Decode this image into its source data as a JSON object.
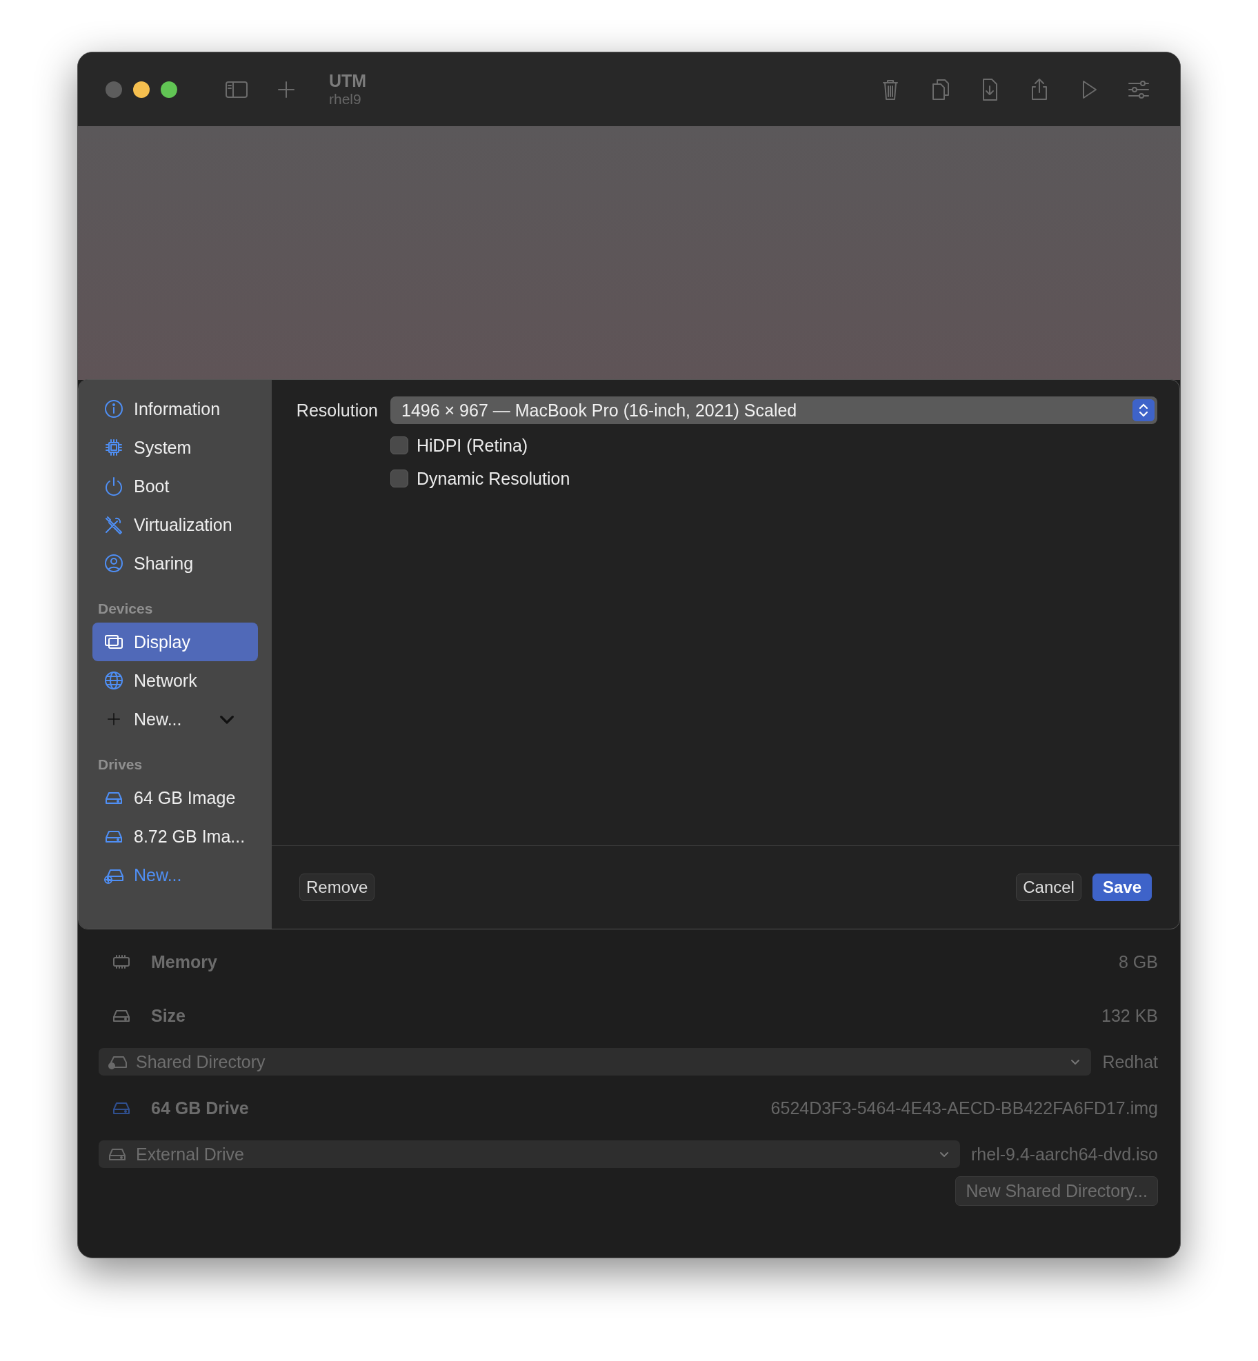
{
  "window": {
    "title": "UTM",
    "subtitle": "rhel9"
  },
  "sidebar": {
    "sections": [
      {
        "items": [
          {
            "kind": "item",
            "label": "Information",
            "selected": false
          },
          {
            "kind": "item",
            "label": "System",
            "selected": false
          },
          {
            "kind": "item",
            "label": "Boot",
            "selected": false
          },
          {
            "kind": "item",
            "label": "Virtualization",
            "selected": false
          },
          {
            "kind": "item",
            "label": "Sharing",
            "selected": false
          }
        ]
      },
      {
        "title": "Devices",
        "items": [
          {
            "kind": "item",
            "label": "Display",
            "selected": true
          },
          {
            "kind": "item",
            "label": "Network",
            "selected": false
          },
          {
            "kind": "add-menu",
            "label": "New..."
          }
        ]
      },
      {
        "title": "Drives",
        "items": [
          {
            "kind": "item",
            "label": "64 GB Image",
            "selected": false
          },
          {
            "kind": "item",
            "label": "8.72 GB Ima...",
            "selected": false
          },
          {
            "kind": "add-link",
            "label": "New..."
          }
        ]
      }
    ]
  },
  "display_settings": {
    "resolution_label": "Resolution",
    "resolution_value": "1496 × 967 — MacBook Pro (16-inch, 2021) Scaled",
    "options": [
      {
        "label": "HiDPI (Retina)",
        "checked": false
      },
      {
        "label": "Dynamic Resolution",
        "checked": false
      }
    ]
  },
  "sheet_buttons": {
    "remove": "Remove",
    "cancel": "Cancel",
    "save": "Save"
  },
  "details": {
    "rows": [
      {
        "kind": "info",
        "label": "Memory",
        "value": "8 GB"
      },
      {
        "kind": "info",
        "label": "Size",
        "value": "132 KB"
      },
      {
        "kind": "select",
        "label": "Shared Directory",
        "value": "Redhat"
      },
      {
        "kind": "info",
        "label": "64 GB Drive",
        "value": "6524D3F3-5464-4E43-AECD-BB422FA6FD17.img"
      },
      {
        "kind": "select",
        "label": "External Drive",
        "value": "rhel-9.4-aarch64-dvd.iso"
      }
    ],
    "button": "New Shared Directory..."
  }
}
